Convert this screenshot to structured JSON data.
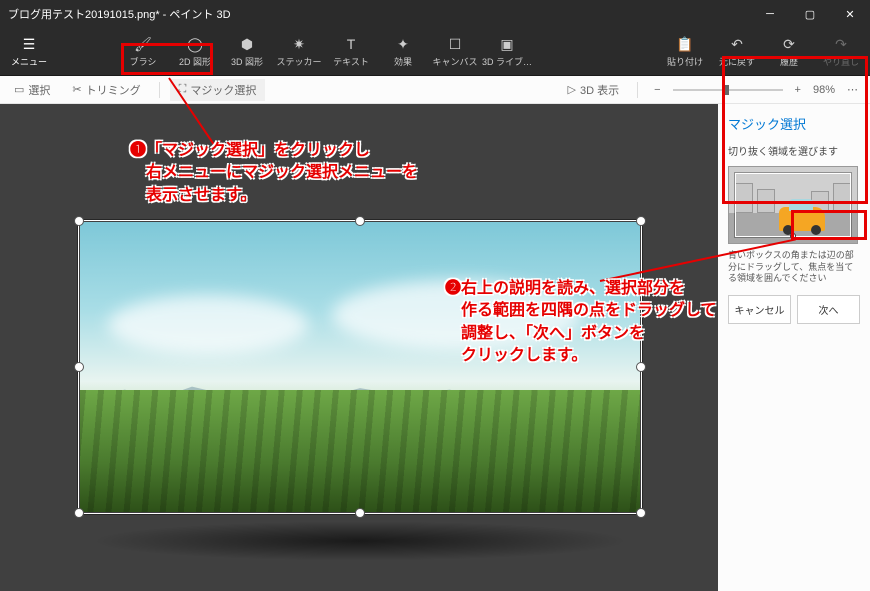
{
  "window": {
    "title": "ブログ用テスト20191015.png* - ペイント 3D"
  },
  "ribbon": {
    "menu": "メニュー",
    "brush": "ブラシ",
    "shape2d": "2D 図形",
    "shape3d": "3D 図形",
    "sticker": "ステッカー",
    "text": "テキスト",
    "effect": "効果",
    "canvas": "キャンバス",
    "lib3d": "3D ライブ…",
    "paste": "貼り付け",
    "undo": "元に戻す",
    "history": "履歴",
    "redo": "やり直し"
  },
  "subtoolbar": {
    "select": "選択",
    "trimming": "トリミング",
    "magic_select": "マジック選択",
    "view3d": "3D 表示",
    "zoom": "98%"
  },
  "sidepanel": {
    "title": "マジック選択",
    "hint": "切り抜く領域を選びます",
    "desc": "青いボックスの角または辺の部分にドラッグして、焦点を当てる領域を囲んでください",
    "cancel": "キャンセル",
    "next": "次へ"
  },
  "annotations": {
    "step1": "❶「マジック選択」をクリックし\n　右メニューにマジック選択メニューを\n　表示させます。",
    "step2": "❷右上の説明を読み、選択部分を\n　作る範囲を四隅の点をドラッグして\n　調整し、「次へ」ボタンを\n　クリックします。"
  }
}
